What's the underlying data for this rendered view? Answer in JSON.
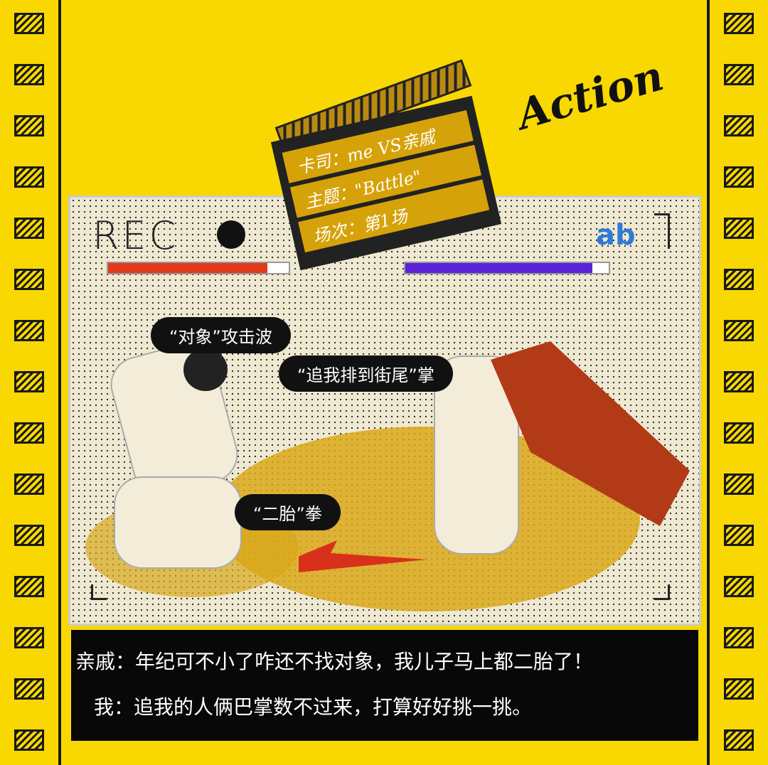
{
  "title_word": "Action",
  "rec_label": "REC",
  "logo": "ab",
  "clapperboard": {
    "cast": "卡司：me VS亲戚",
    "theme": "主题：\"Battle\"",
    "scene": "场次：第1场"
  },
  "health_bars": {
    "left": {
      "percent": 88,
      "color": "#e03a1c"
    },
    "right": {
      "percent": 92,
      "color": "#5a22d8"
    }
  },
  "bubbles": [
    "“对象”攻击波",
    "“追我排到街尾”掌",
    "“二胎”拳"
  ],
  "dialogue": [
    {
      "speaker": "亲戚：",
      "line": "年纪可不小了咋还不找对象，我儿子马上都二胎了！"
    },
    {
      "speaker": "我：",
      "line": "追我的人俩巴掌数不过来，打算好好挑一挑。"
    }
  ]
}
